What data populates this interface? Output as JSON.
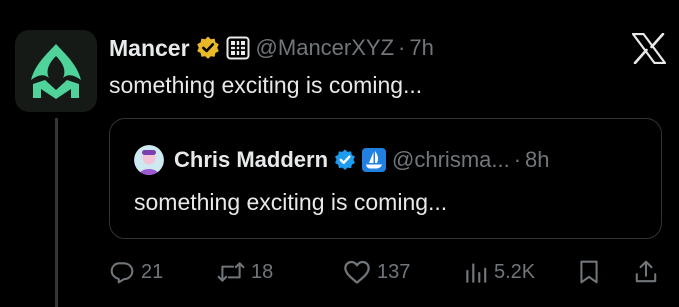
{
  "tweet": {
    "author_name": "Mancer",
    "handle": "@MancerXYZ",
    "separator": "·",
    "time": "7h",
    "text": "something exciting is coming...",
    "icons": [
      "mancer-logo",
      "gold-verified-badge",
      "affiliate-badge",
      "x-logo"
    ]
  },
  "quoted_tweet": {
    "author_name": "Chris Maddern",
    "handle": "@chrisma...",
    "separator": "·",
    "time": "8h",
    "text": "something exciting is coming...",
    "icons": [
      "avatar",
      "blue-verified-badge",
      "opensea-badge"
    ]
  },
  "actions": {
    "replies": "21",
    "reposts": "18",
    "likes": "137",
    "views": "5.2K",
    "icons": [
      "reply-icon",
      "repost-icon",
      "like-icon",
      "views-icon",
      "bookmark-icon",
      "share-icon"
    ]
  },
  "colors": {
    "background": "#000000",
    "text": "#e7e9ea",
    "muted": "#71767b",
    "border": "#2f3336",
    "brand_green": "#4fd39a",
    "verified_gold": "#e8b829",
    "verified_blue": "#1d9bf0"
  }
}
